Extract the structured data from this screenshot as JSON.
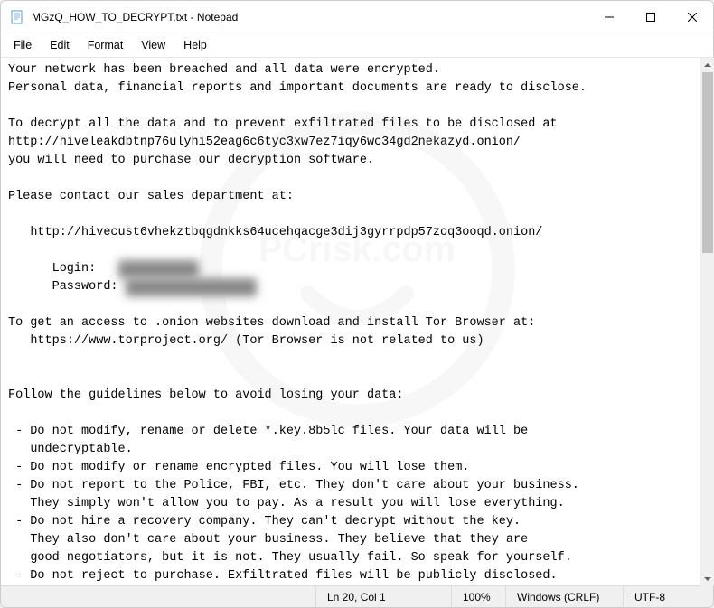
{
  "window": {
    "title": "MGzQ_HOW_TO_DECRYPT.txt - Notepad"
  },
  "menubar": {
    "file": "File",
    "edit": "Edit",
    "format": "Format",
    "view": "View",
    "help": "Help"
  },
  "content": {
    "line1": "Your network has been breached and all data were encrypted.",
    "line2": "Personal data, financial reports and important documents are ready to disclose.",
    "line3": "",
    "line4": "To decrypt all the data and to prevent exfiltrated files to be disclosed at",
    "line5": "http://hiveleakdbtnp76ulyhi52eag6c6tyc3xw7ez7iqy6wc34gd2nekazyd.onion/",
    "line6": "you will need to purchase our decryption software.",
    "line7": "",
    "line8": "Please contact our sales department at:",
    "line9": "",
    "line10": "   http://hivecust6vhekztbqgdnkks64ucehqacge3dij3gyrrpdp57zoq3ooqd.onion/",
    "line11": "",
    "login_label": "      Login:   ",
    "login_value_redacted": "xxxxxxxxxxx",
    "password_label": "      Password: ",
    "password_value_redacted": "xxxxxxxxxxxxxxxxxx",
    "line14": "",
    "line15": "To get an access to .onion websites download and install Tor Browser at:",
    "line16": "   https://www.torproject.org/ (Tor Browser is not related to us)",
    "line17": "",
    "line18": "",
    "line19": "Follow the guidelines below to avoid losing your data:",
    "line20": "",
    "line21": " - Do not modify, rename or delete *.key.8b5lc files. Your data will be",
    "line22": "   undecryptable.",
    "line23": " - Do not modify or rename encrypted files. You will lose them.",
    "line24": " - Do not report to the Police, FBI, etc. They don't care about your business.",
    "line25": "   They simply won't allow you to pay. As a result you will lose everything.",
    "line26": " - Do not hire a recovery company. They can't decrypt without the key.",
    "line27": "   They also don't care about your business. They believe that they are",
    "line28": "   good negotiators, but it is not. They usually fail. So speak for yourself.",
    "line29": " - Do not reject to purchase. Exfiltrated files will be publicly disclosed."
  },
  "statusbar": {
    "position": "Ln 20, Col 1",
    "zoom": "100%",
    "line_ending": "Windows (CRLF)",
    "encoding": "UTF-8"
  },
  "watermark_text": "PCrisk.com"
}
